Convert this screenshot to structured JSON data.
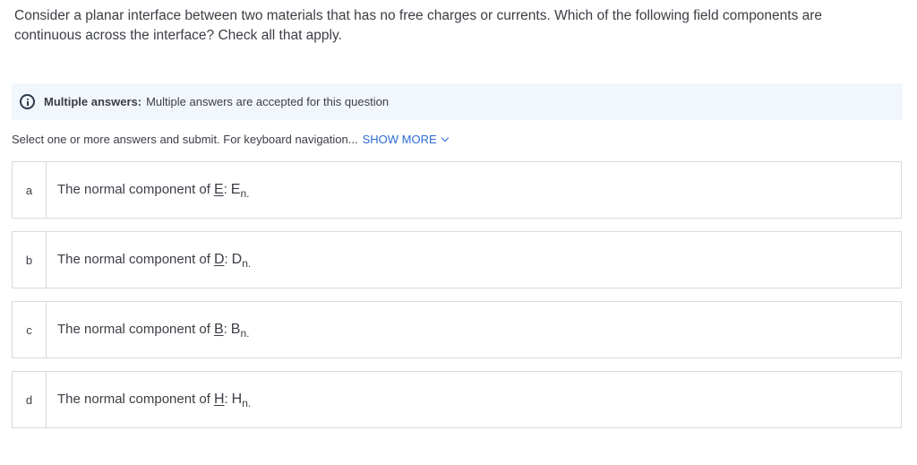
{
  "question": {
    "text": "Consider a planar interface between two materials that has no free charges or currents. Which of the following field components are continuous across the interface? Check all that apply."
  },
  "info": {
    "icon": "info-icon",
    "title": "Multiple answers:",
    "text": "Multiple answers are accepted for this question"
  },
  "instructions": {
    "text": "Select one or more answers and submit. For keyboard navigation...",
    "show_more": "SHOW MORE",
    "accent_color": "#2d6bd6"
  },
  "options": [
    {
      "letter": "a",
      "prefix": "The normal component of",
      "vector": "E",
      "component": "E",
      "subscript": "n."
    },
    {
      "letter": "b",
      "prefix": "The normal component of",
      "vector": "D",
      "component": "D",
      "subscript": "n."
    },
    {
      "letter": "c",
      "prefix": "The normal component of",
      "vector": "B",
      "component": "B",
      "subscript": "n."
    },
    {
      "letter": "d",
      "prefix": "The normal component of",
      "vector": "H",
      "component": "H",
      "subscript": "n."
    }
  ]
}
